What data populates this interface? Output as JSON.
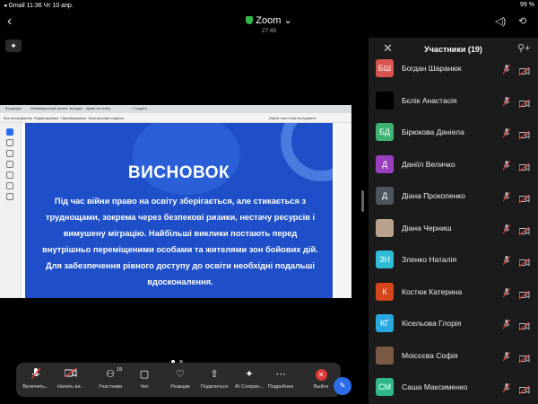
{
  "status_bar": {
    "left": "◂ Gmail  11:36  Чт 10 апр.",
    "right": "99 %"
  },
  "header": {
    "title": "Zoom",
    "timer": "27:45"
  },
  "share": {
    "tabs": [
      "Входящие",
      "Инновационный проект: вкладка",
      "право на освіту",
      "+ Создать"
    ],
    "ribbon": [
      "Все инструменты",
      "Редактировать",
      "Преобразовать",
      "Электронная подпись"
    ],
    "ribbon_right": "Найти текст или инструмент",
    "slide": {
      "heading": "ВИСНОВОК",
      "body": "Під час війни право на освіту зберігається, але стикається з труднощами, зокрема через безпекові ризики, нестачу ресурсів і вимушену міграцію. Найбільші виклики постають перед внутрішньо переміщеними особами та жителями зон бойових дій. Для забезпечення рівного доступу до освіти необхідні подальші вдосконалення."
    }
  },
  "toolbar": {
    "items": [
      {
        "label": "Включить...",
        "icon": "mic-off-icon"
      },
      {
        "label": "Начать ви...",
        "icon": "video-off-icon"
      },
      {
        "label": "Участники",
        "icon": "participants-icon",
        "badge": "19"
      },
      {
        "label": "Чат",
        "icon": "chat-icon"
      },
      {
        "label": "Реакции",
        "icon": "heart-icon"
      },
      {
        "label": "Поделиться",
        "icon": "share-icon"
      },
      {
        "label": "AI Compan...",
        "icon": "ai-sparkle-icon"
      },
      {
        "label": "Подробнее",
        "icon": "more-icon"
      },
      {
        "label": "Выйти",
        "icon": "leave-icon"
      }
    ],
    "colors": {
      "leave": "#e03a3a"
    }
  },
  "participants_panel": {
    "title": "Участники (19)",
    "participants": [
      {
        "initials": "БШ",
        "name": "Богдан Шаранюк",
        "color": "#d9534f"
      },
      {
        "initials": "",
        "name": "Бєлік Анастасія",
        "color": "#000000"
      },
      {
        "initials": "БД",
        "name": "Бірюкова Даніела",
        "color": "#3cb371"
      },
      {
        "initials": "Д",
        "name": "Даніїл Величко",
        "color": "#9b3fc1"
      },
      {
        "initials": "Д",
        "name": "Діана Прокопенко",
        "color": "#4a5560"
      },
      {
        "initials": "",
        "name": "Діана Черниш",
        "color": "#b9a38c"
      },
      {
        "initials": "ЗН",
        "name": "Зленко Наталія",
        "color": "#2fbcd6"
      },
      {
        "initials": "К",
        "name": "Костюк Катерина",
        "color": "#d6451b"
      },
      {
        "initials": "КГ",
        "name": "Кісельова Глорія",
        "color": "#29a7e0"
      },
      {
        "initials": "",
        "name": "Моісєєва Софія",
        "color": "#7b5a45"
      },
      {
        "initials": "СМ",
        "name": "Саша Максименко",
        "color": "#30b78c"
      }
    ]
  }
}
